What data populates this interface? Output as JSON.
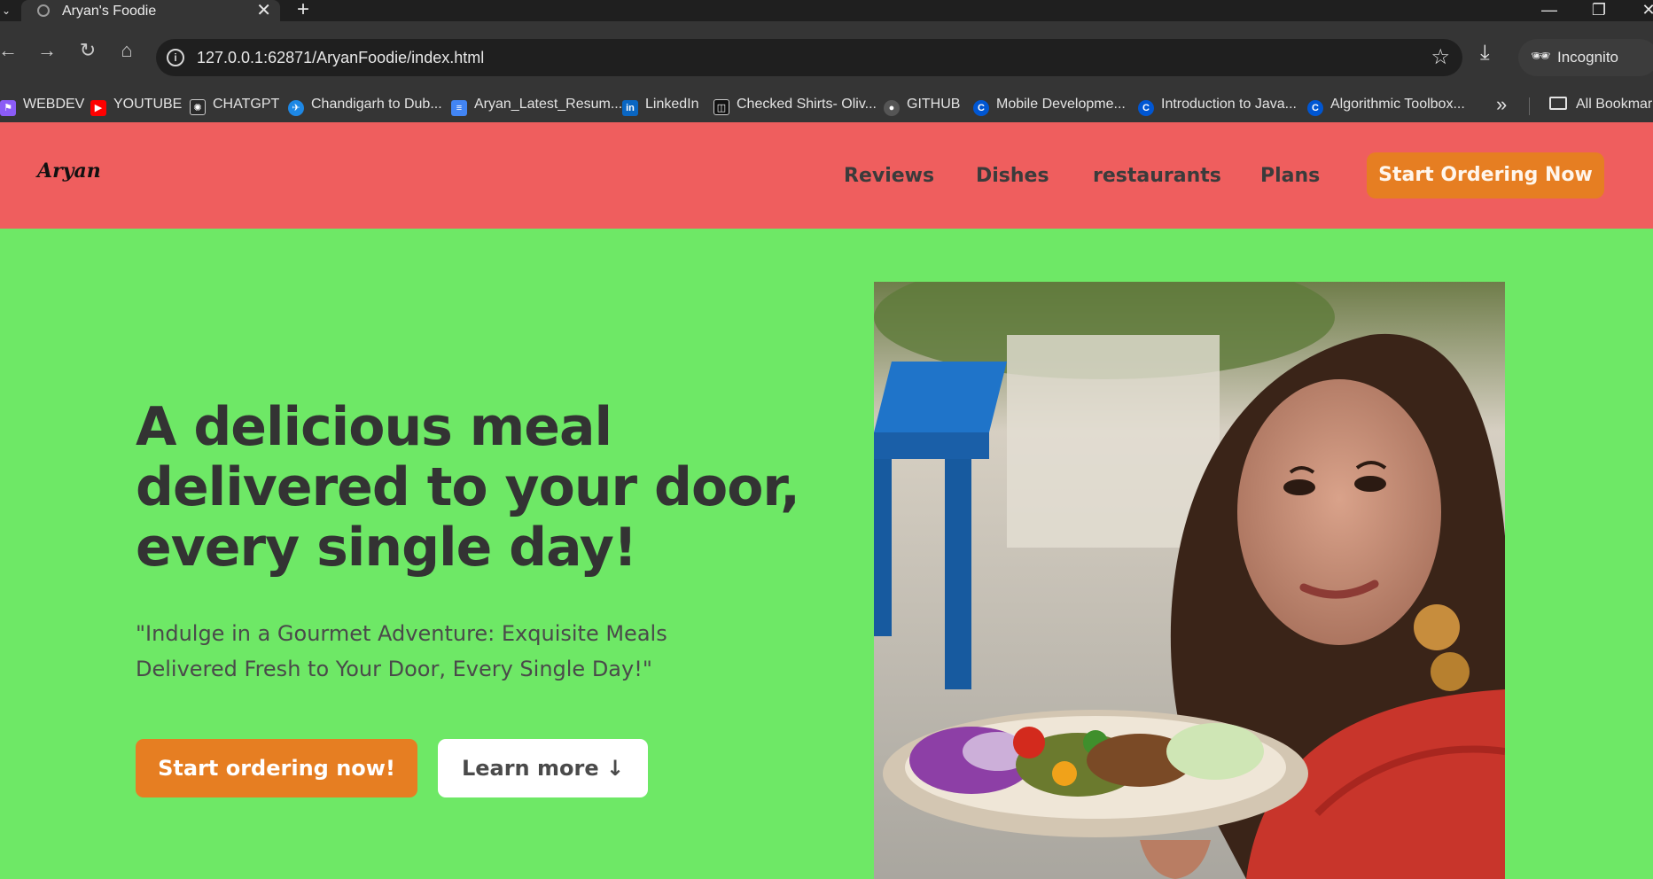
{
  "browser": {
    "tab": {
      "title": "Aryan's Foodie",
      "close": "✕"
    },
    "new_tab": "+",
    "window_controls": {
      "minimize": "—",
      "restore": "❐",
      "close": "✕"
    },
    "nav": {
      "back": "←",
      "forward": "→",
      "reload": "↻",
      "home": "⌂"
    },
    "url": "127.0.0.1:62871/AryanFoodie/index.html",
    "incognito_label": "Incognito",
    "bookmarks": [
      {
        "label": "WEBDEV",
        "icon": "webdev-icon",
        "color": "#8b5cf6"
      },
      {
        "label": "YOUTUBE",
        "icon": "youtube-icon",
        "color": "#ff0000"
      },
      {
        "label": "CHATGPT",
        "icon": "chatgpt-icon",
        "color": "#2a2a2a"
      },
      {
        "label": "Chandigarh to Dub...",
        "icon": "flight-icon",
        "color": "#1e88e5"
      },
      {
        "label": "Aryan_Latest_Resum...",
        "icon": "doc-icon",
        "color": "#4285f4"
      },
      {
        "label": "LinkedIn",
        "icon": "linkedin-icon",
        "color": "#0a66c2"
      },
      {
        "label": "Checked Shirts- Oliv...",
        "icon": "shop-icon",
        "color": "#111111"
      },
      {
        "label": "GITHUB",
        "icon": "github-icon",
        "color": "#555555"
      },
      {
        "label": "Mobile Developme...",
        "icon": "coursera-icon",
        "color": "#0056d2"
      },
      {
        "label": "Introduction to Java...",
        "icon": "coursera-icon",
        "color": "#0056d2"
      },
      {
        "label": "Algorithmic Toolbox...",
        "icon": "coursera-icon",
        "color": "#0056d2"
      }
    ],
    "bookmarks_more": "»",
    "all_bookmarks": "All Bookmarks"
  },
  "site": {
    "logo": "Aryan",
    "nav": [
      "Reviews",
      "Dishes",
      "restaurants",
      "Plans"
    ],
    "nav_cta": "Start Ordering Now"
  },
  "hero": {
    "title": "A delicious meal delivered to your door, every single day!",
    "description": "\"Indulge in a Gourmet Adventure: Exquisite Meals Delivered Fresh to Your Door, Every Single Day!\"",
    "primary_button": "Start ordering now!",
    "secondary_button": "Learn more ↓"
  },
  "colors": {
    "header_bg": "#ef5e5e",
    "hero_bg": "#6ee866",
    "accent": "#e67e22"
  }
}
